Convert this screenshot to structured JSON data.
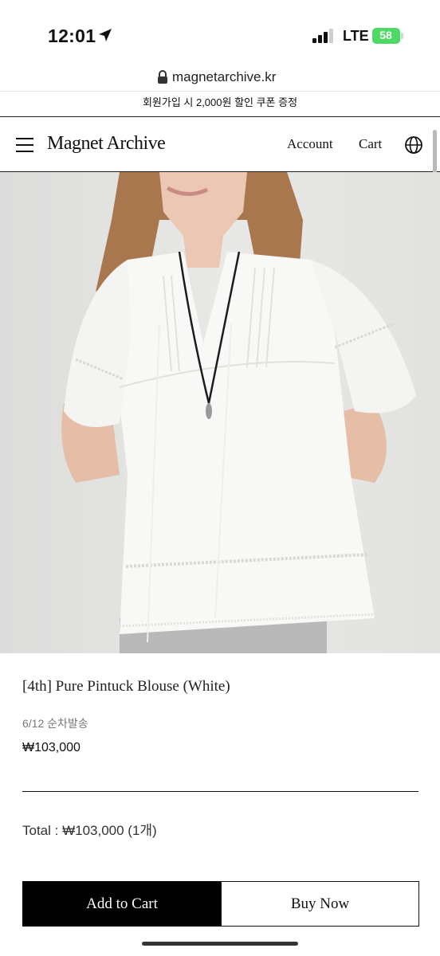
{
  "status_bar": {
    "time": "12:01",
    "network": "LTE",
    "battery": "58",
    "icons": [
      "location-arrow-icon",
      "signal-bars-icon",
      "battery-icon"
    ]
  },
  "browser": {
    "url": "magnetarchive.kr"
  },
  "promo_banner": {
    "text": "회원가입 시 2,000원 할인 쿠폰 증정"
  },
  "header": {
    "logo": "Magnet Archive",
    "nav": {
      "account": "Account",
      "cart": "Cart"
    },
    "icons": [
      "hamburger-menu-icon",
      "globe-icon"
    ]
  },
  "product": {
    "title": "[4th] Pure Pintuck Blouse (White)",
    "shipping_note": "6/12 순차발송",
    "price": "₩103,000",
    "total": "Total : ₩103,000 (1개)",
    "colors": {
      "primary_button_bg": "#000000",
      "blouse": "#f8f8f6",
      "background": "#e4e4e2"
    }
  },
  "actions": {
    "add_to_cart": "Add to Cart",
    "buy_now": "Buy Now"
  }
}
